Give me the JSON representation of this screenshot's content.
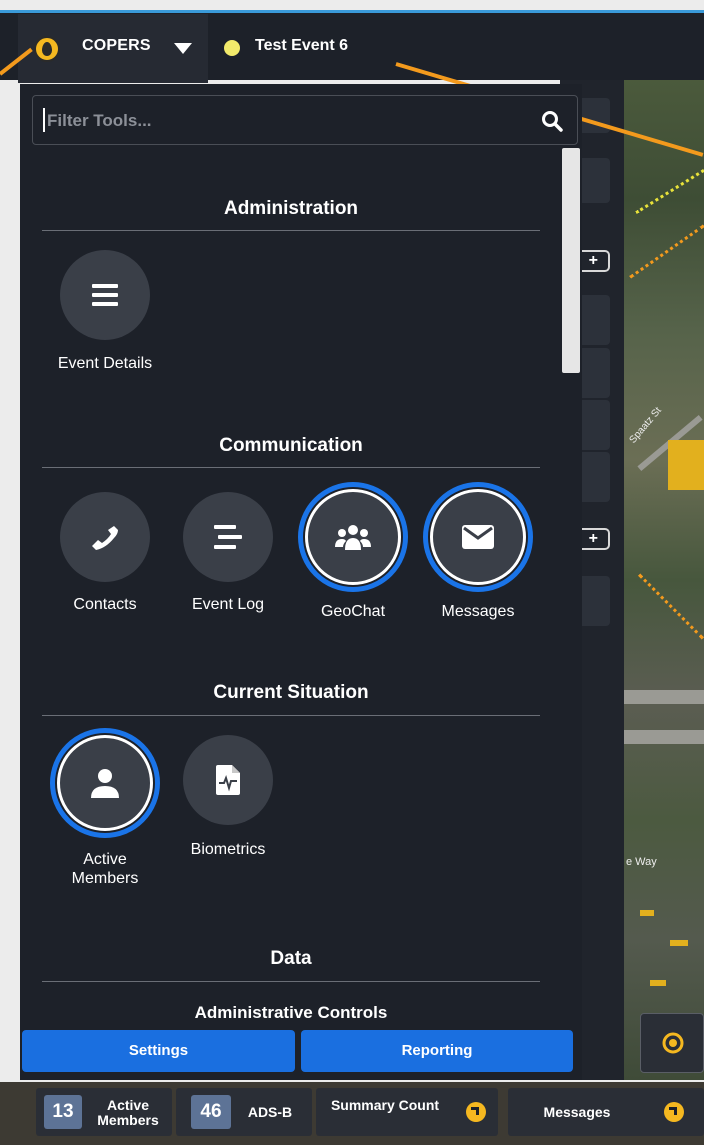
{
  "header": {
    "brand_label": "COPERS",
    "event_label": "Test Event 6",
    "accent_color": "#3a9ad9",
    "pointer_color": "#f39a1d"
  },
  "search": {
    "placeholder": "Filter Tools..."
  },
  "sections": {
    "administration": {
      "title": "Administration",
      "tools": [
        {
          "label": "Event Details",
          "icon": "menu-icon"
        }
      ]
    },
    "communication": {
      "title": "Communication",
      "tools": [
        {
          "label": "Contacts",
          "icon": "phone-icon"
        },
        {
          "label": "Event Log",
          "icon": "list-icon"
        },
        {
          "label": "GeoChat",
          "icon": "group-icon",
          "active": true
        },
        {
          "label": "Messages",
          "icon": "envelope-icon",
          "active": true
        }
      ]
    },
    "current_situation": {
      "title": "Current Situation",
      "tools": [
        {
          "label": "Active Members",
          "icon": "user-icon",
          "active": true
        },
        {
          "label": "Biometrics",
          "icon": "file-pulse-icon"
        }
      ]
    },
    "data": {
      "title": "Data",
      "subtitle": "Administrative Controls"
    }
  },
  "footer_buttons": {
    "settings": "Settings",
    "reporting": "Reporting"
  },
  "status_bar": {
    "active_members_count": "13",
    "active_members_label": "Active Members",
    "adsb_count": "46",
    "adsb_label": "ADS-B",
    "summary_label": "Summary Count",
    "messages_label": "Messages"
  },
  "map": {
    "street_label_1": "Spaatz St",
    "street_label_2": "e Way"
  },
  "colors": {
    "active_ring": "#1a74e8",
    "button_blue": "#1a6fe0",
    "panel_bg": "#1d2129"
  }
}
